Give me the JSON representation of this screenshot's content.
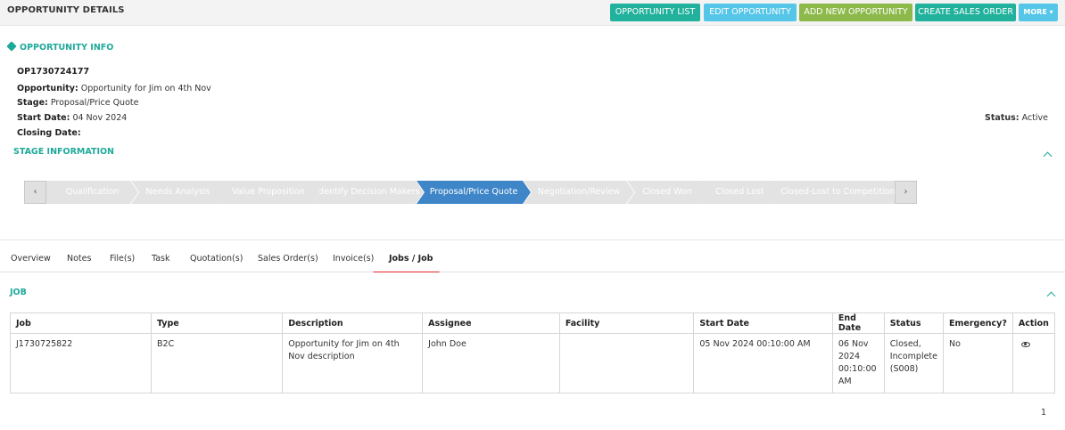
{
  "header": {
    "title": "OPPORTUNITY DETAILS",
    "buttons": {
      "opportunity_list": "OPPORTUNITY LIST",
      "edit_opportunity": "EDIT OPPORTUNITY",
      "add_new_opportunity": "ADD NEW OPPORTUNITY",
      "create_sales_order": "CREATE SALES ORDER",
      "more": "MORE ▾"
    }
  },
  "info": {
    "section_title": "OPPORTUNITY INFO",
    "id": "OP1730724177",
    "opportunity_label": "Opportunity:",
    "opportunity_value": " Opportunity for Jim on 4th Nov",
    "stage_label": "Stage:",
    "stage_value": " Proposal/Price Quote",
    "start_date_label": "Start Date:",
    "start_date_value": " 04 Nov 2024",
    "closing_date_label": "Closing Date:",
    "closing_date_value": "",
    "status_label": "Status:",
    "status_value": " Active"
  },
  "stage_info": {
    "title": "STAGE INFORMATION",
    "prev": "‹",
    "next": "›",
    "stages": [
      "Qualification",
      "Needs Analysis",
      "Value Proposition",
      "Identify Decision Makers",
      "Proposal/Price Quote",
      "Negotiation/Review",
      "Closed Won",
      "Closed Lost",
      "Closed-Lost to Competition"
    ],
    "active_stage": "Proposal/Price Quote"
  },
  "tabs": [
    "Overview",
    "Notes",
    "File(s)",
    "Task",
    "Quotation(s)",
    "Sales Order(s)",
    "Invoice(s)",
    "Jobs / Job"
  ],
  "active_tab": "Jobs / Job",
  "job": {
    "section_title": "JOB",
    "columns": [
      "Job",
      "Type",
      "Description",
      "Assignee",
      "Facility",
      "Start Date",
      "End Date",
      "Status",
      "Emergency?",
      "Action"
    ],
    "rows": [
      {
        "job": "J1730725822",
        "type": "B2C",
        "description": "Opportunity for Jim on 4th Nov description",
        "assignee": "John Doe",
        "facility": "",
        "start_date": "05 Nov 2024 00:10:00 AM",
        "end_date": "06 Nov 2024 00:10:00 AM",
        "status": "Closed, Incomplete (S008)",
        "emergency": "No"
      }
    ]
  },
  "pagination": {
    "page": "1"
  },
  "colors": {
    "accent": "#1fa99a",
    "active_stage": "#3f86c8",
    "active_tab_underline": "#e0232a"
  }
}
